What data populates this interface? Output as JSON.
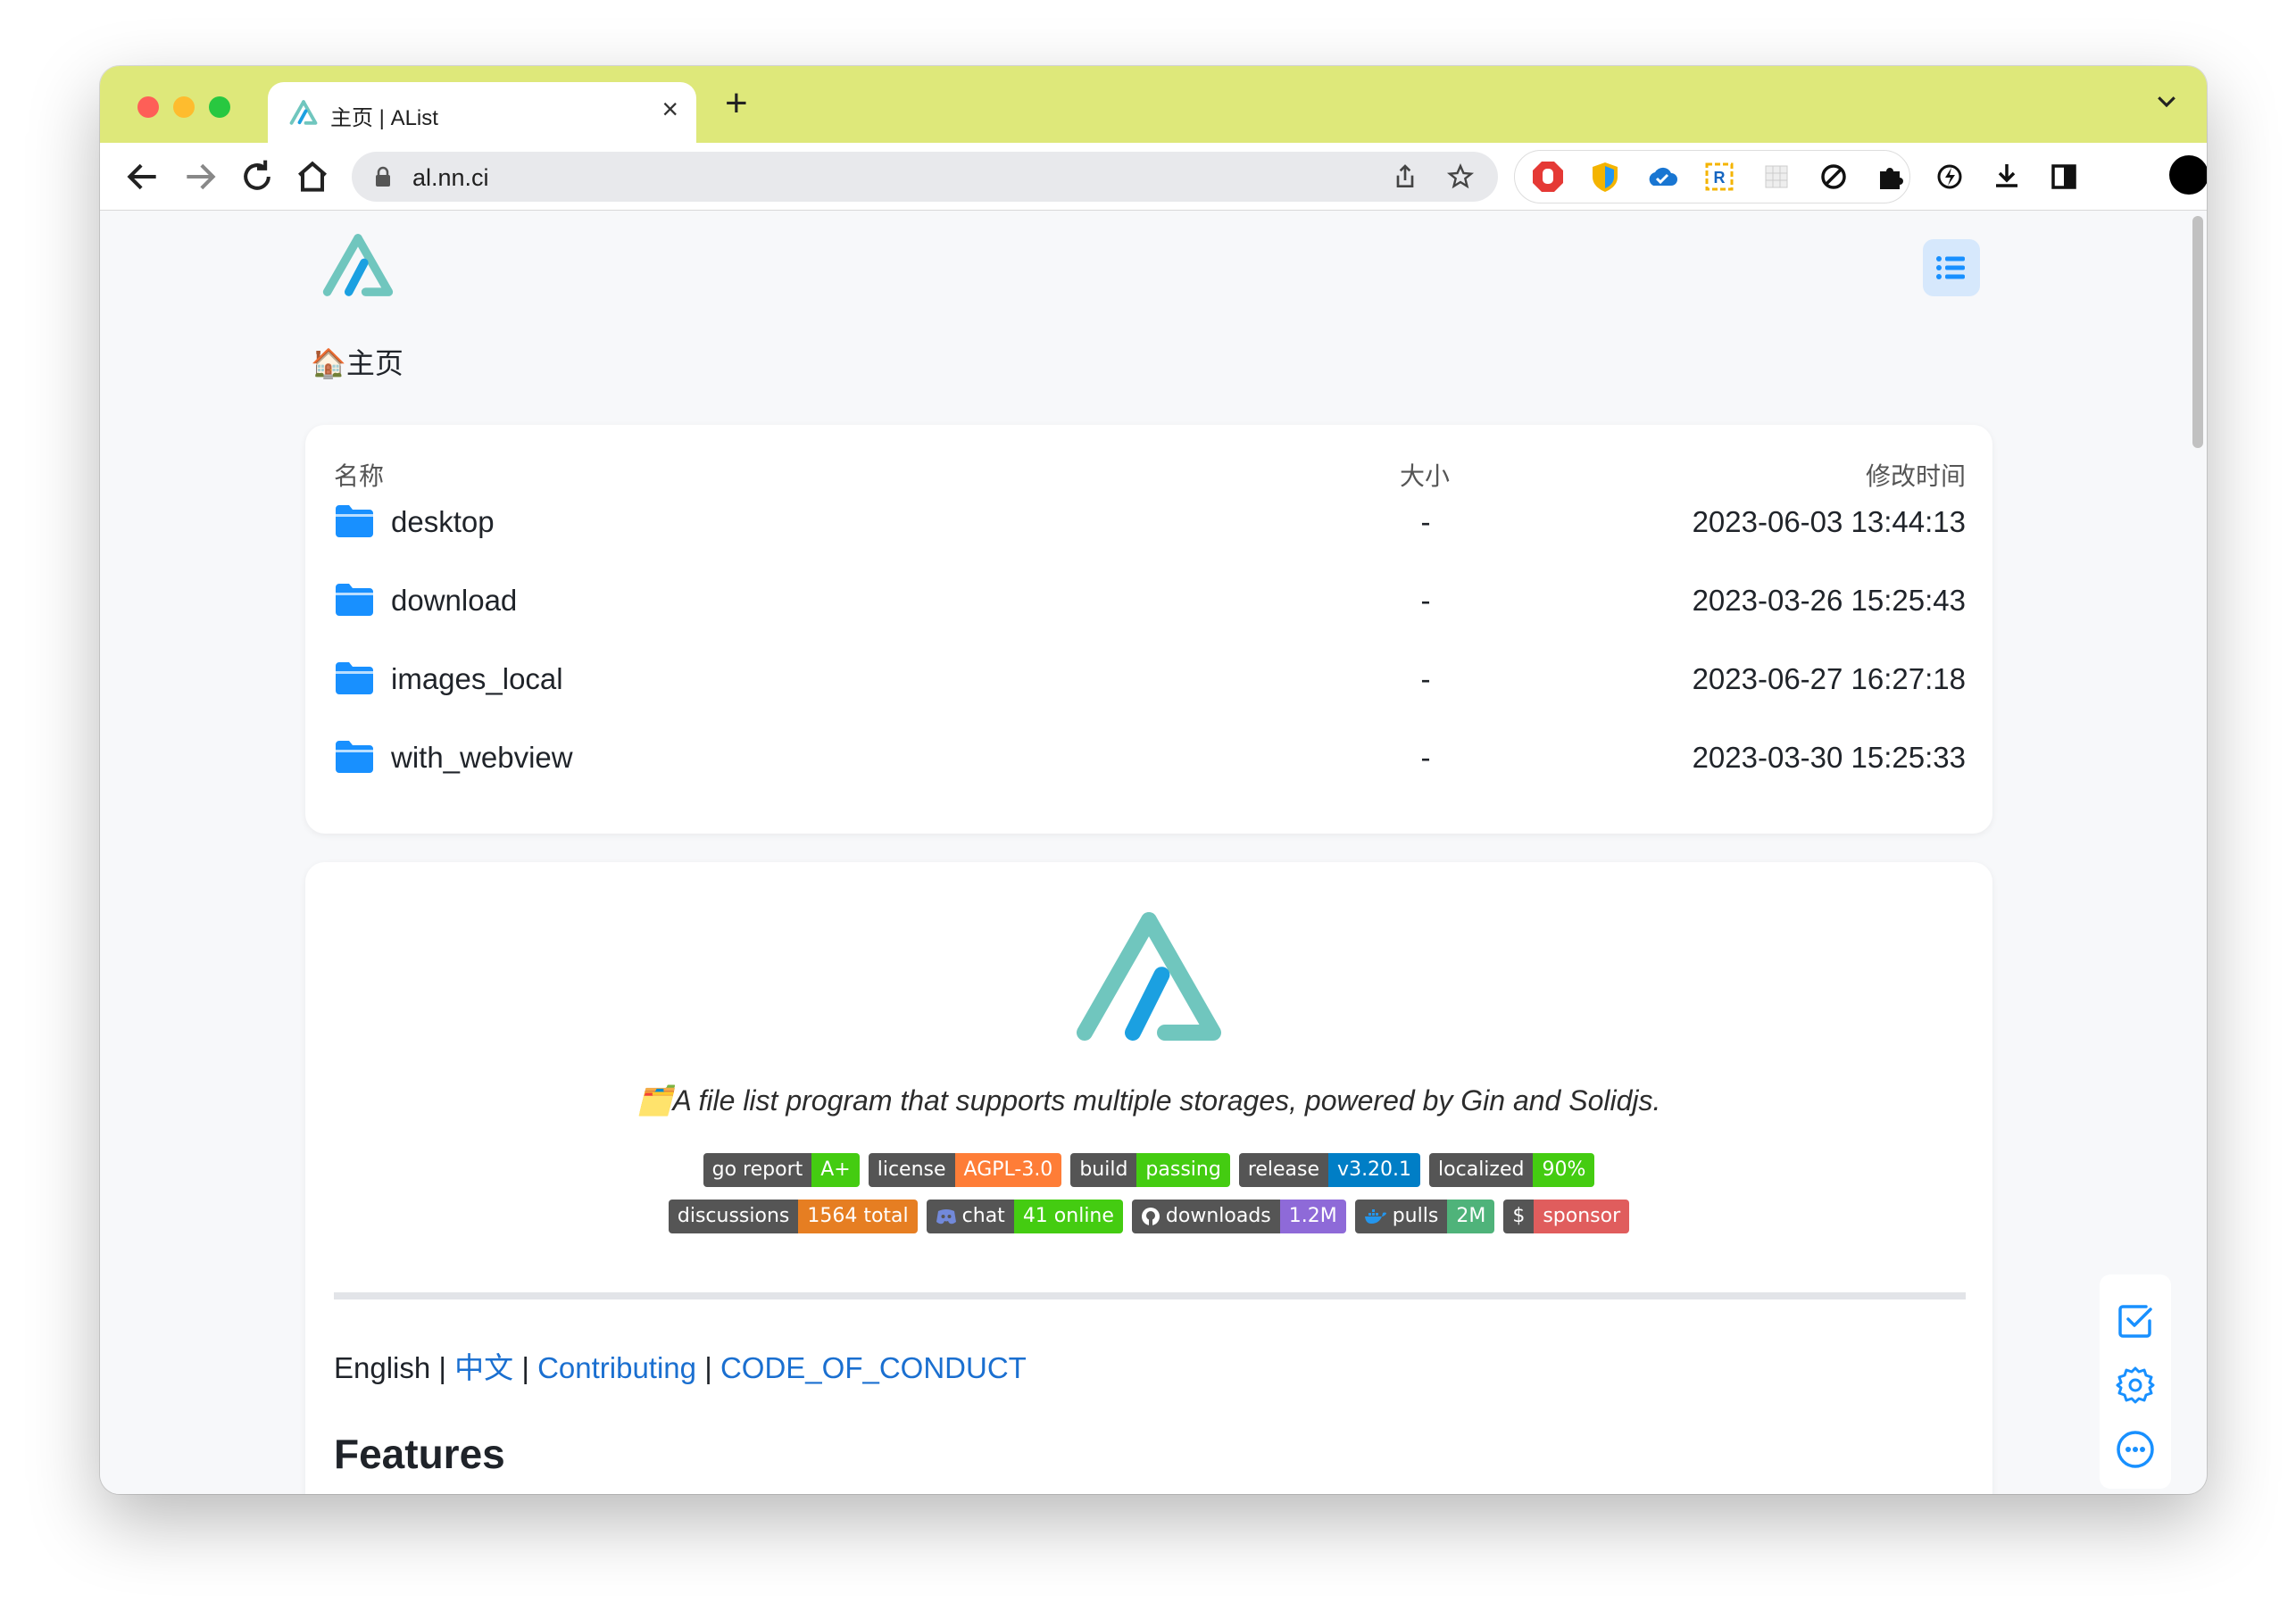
{
  "browser": {
    "tab_title": "主页 | AList",
    "url": "al.nn.ci",
    "tab_bar_color": "#dee87a"
  },
  "page": {
    "breadcrumb": "🏠主页",
    "table": {
      "headers": {
        "name": "名称",
        "size": "大小",
        "modified": "修改时间"
      },
      "rows": [
        {
          "name": "desktop",
          "size": "-",
          "modified": "2023-06-03 13:44:13"
        },
        {
          "name": "download",
          "size": "-",
          "modified": "2023-03-26 15:25:43"
        },
        {
          "name": "images_local",
          "size": "-",
          "modified": "2023-06-27 16:27:18"
        },
        {
          "name": "with_webview",
          "size": "-",
          "modified": "2023-03-30 15:25:33"
        }
      ]
    },
    "readme": {
      "tagline": "🗂️A file list program that supports multiple storages, powered by Gin and Solidjs.",
      "badges_row1": [
        {
          "label": "go report",
          "value": "A+",
          "color": "#4c1"
        },
        {
          "label": "license",
          "value": "AGPL-3.0",
          "color": "#fe7d37"
        },
        {
          "label": "build",
          "value": "passing",
          "color": "#4c1"
        },
        {
          "label": "release",
          "value": "v3.20.1",
          "color": "#007ec6"
        },
        {
          "label": "localized",
          "value": "90%",
          "color": "#4c1"
        }
      ],
      "badges_row2": [
        {
          "label": "discussions",
          "value": "1564 total",
          "color": "#e67e22"
        },
        {
          "label": "chat",
          "value": "41 online",
          "color": "#4c1",
          "icon": "discord"
        },
        {
          "label": "downloads",
          "value": "1.2M",
          "color": "#8e6ad8",
          "icon": "github"
        },
        {
          "label": "pulls",
          "value": "2M",
          "color": "#4fb37a",
          "icon": "docker"
        },
        {
          "label": "$",
          "value": "sponsor",
          "color": "#e05d5d"
        }
      ],
      "links": {
        "english": "English",
        "sep": "|",
        "chinese": "中文",
        "contributing": "Contributing",
        "coc": "CODE_OF_CONDUCT"
      },
      "features_heading": "Features"
    }
  },
  "colors": {
    "accent": "#1890ff",
    "logo_teal": "#70c6be",
    "logo_blue": "#1ba0e1"
  }
}
